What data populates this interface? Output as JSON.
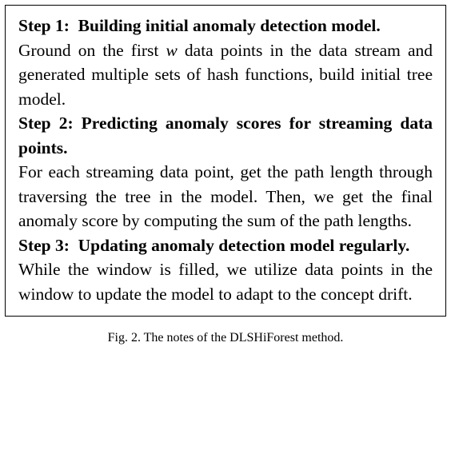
{
  "steps": [
    {
      "title_a": "Step 1:",
      "title_b": "Building initial anomaly detection model.",
      "body_pre": "Ground on the first ",
      "body_var": "w",
      "body_post": " data points in the data stream and generated multiple sets of hash func­tions, build initial tree model."
    },
    {
      "title_a": "Step 2: Predicting anomaly scores for stream­ing data points.",
      "title_b": "",
      "body_pre": "For each streaming data point, get the path length through traversing the tree in the model. Then, we get the final anomaly score by computing the sum of the path lengths.",
      "body_var": "",
      "body_post": ""
    },
    {
      "title_a": "Step 3:",
      "title_b": "Updating anomaly detection model regularly.",
      "body_pre": "While the window is filled, we utilize data points in the window to update the model to adapt to the concept drift.",
      "body_var": "",
      "body_post": ""
    }
  ],
  "caption_partial": "Fig. 2. The notes of the DLSHiForest method."
}
